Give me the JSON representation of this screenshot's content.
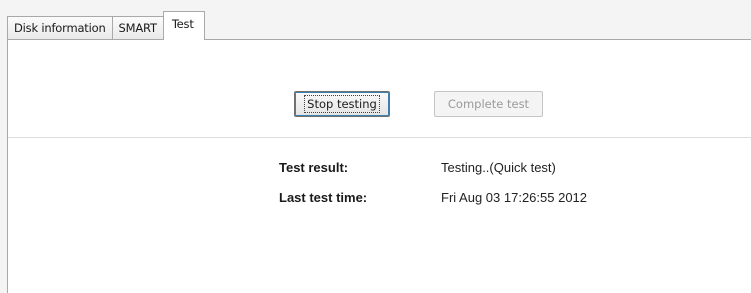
{
  "tabs": [
    {
      "label": "Disk information",
      "active": false
    },
    {
      "label": "SMART",
      "active": false
    },
    {
      "label": "Test",
      "active": true
    }
  ],
  "actions": {
    "stop_testing_label": "Stop testing",
    "complete_test_label": "Complete test"
  },
  "info": {
    "test_result_label": "Test result:",
    "test_result_value": "Testing..(Quick test)",
    "last_test_time_label": "Last test time:",
    "last_test_time_value": "Fri Aug 03 17:26:55 2012"
  },
  "colors": {
    "background": "#f4f4f4",
    "panel": "#ffffff",
    "focus_ring": "#3c7fb1",
    "disabled_text": "#9a9a9a"
  }
}
